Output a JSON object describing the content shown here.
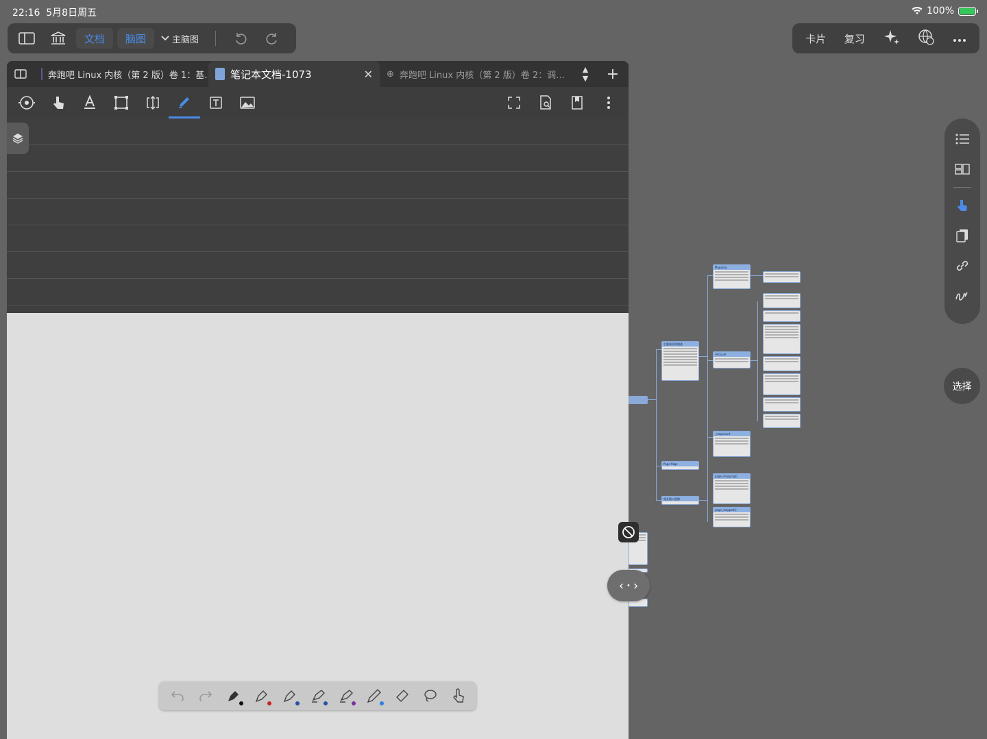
{
  "status": {
    "time": "22:16",
    "date": "5月8日周五",
    "battery": "100%"
  },
  "toolbar": {
    "doc_label": "文档",
    "mindmap_label": "脑图",
    "mindmap_selector": "主脑图"
  },
  "right_toolbar": {
    "cards": "卡片",
    "review": "复习"
  },
  "tabs": [
    {
      "label": "奔跑吧 Linux 内核（第 2 版）卷 1：基…"
    },
    {
      "label": "笔记本文档-1073"
    },
    {
      "label": "奔跑吧 Linux 内核（第 2 版）卷 2：调…"
    }
  ],
  "select_button": "选择",
  "mindmap": {
    "nodes": [
      {
        "title": "Mapping"
      },
      {
        "title": "主要成员的描述"
      },
      {
        "title": "refcount"
      },
      {
        "title": "_mapcount"
      },
      {
        "title": "Page flags"
      },
      {
        "title": "相关接口函数"
      },
      {
        "title": "page_mapping()"
      },
      {
        "title": "page_mapped()"
      }
    ]
  },
  "colors": {
    "accent": "#4a8be8",
    "node_header": "#8db0e2"
  }
}
